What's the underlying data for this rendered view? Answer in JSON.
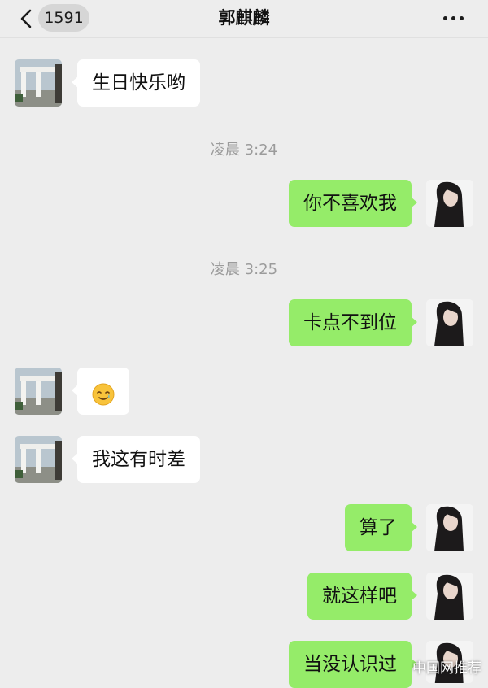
{
  "header": {
    "back_icon": "chevron-left-icon",
    "unread_count": "1591",
    "title": "郭麒麟",
    "more_icon": "ellipsis-icon"
  },
  "timestamps": [
    "凌晨 3:24",
    "凌晨 3:25"
  ],
  "messages": [
    {
      "side": "left",
      "text": "生日快乐哟"
    },
    {
      "side": "right",
      "text": "你不喜欢我"
    },
    {
      "side": "right",
      "text": "卡点不到位"
    },
    {
      "side": "left",
      "text": "🥲",
      "type": "emoji"
    },
    {
      "side": "left",
      "text": "我这有时差"
    },
    {
      "side": "right",
      "text": "算了"
    },
    {
      "side": "right",
      "text": "就这样吧"
    },
    {
      "side": "right",
      "text": "当没认识过"
    }
  ],
  "avatars": {
    "left": "archway-landscape-photo",
    "right": "woman-portrait-photo"
  },
  "watermark": "中国网推荐",
  "colors": {
    "background": "#ededed",
    "sent_bubble": "#95ec69",
    "received_bubble": "#ffffff",
    "timestamp": "#9b9b9b"
  }
}
